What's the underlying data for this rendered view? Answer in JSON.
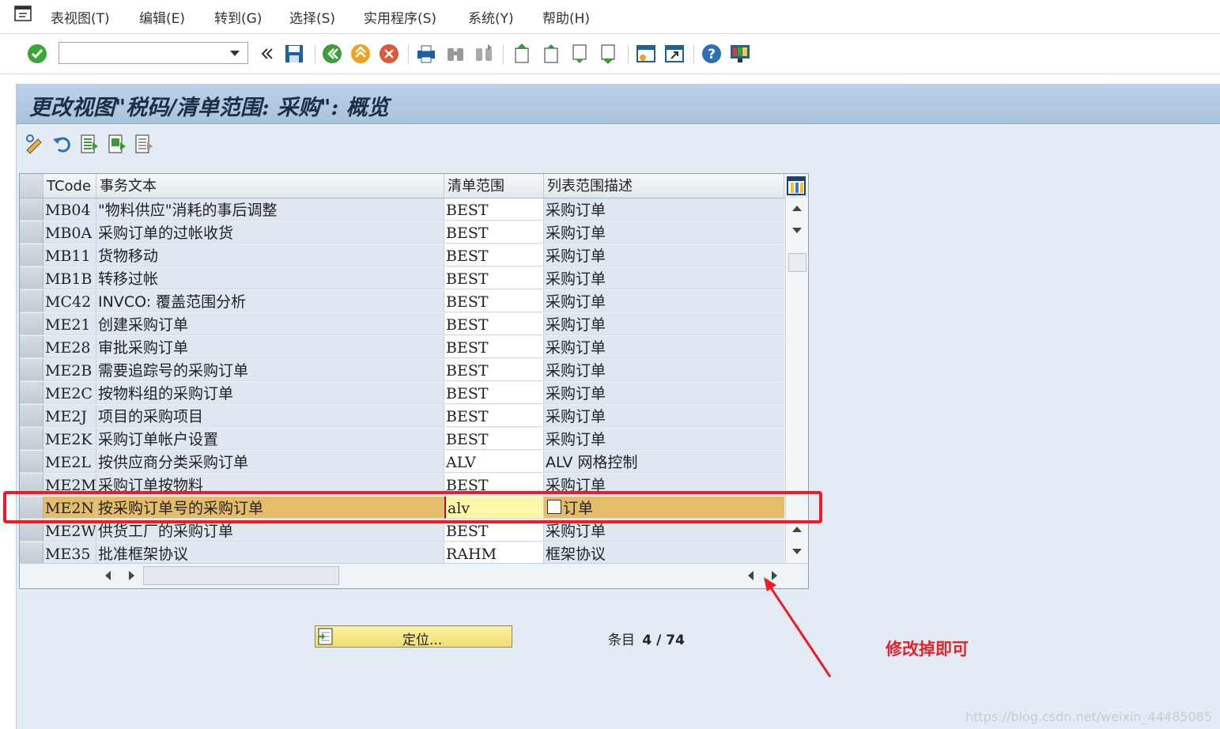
{
  "menu": [
    "表视图(T)",
    "编辑(E)",
    "转到(G)",
    "选择(S)",
    "实用程序(S)",
    "系统(Y)",
    "帮助(H)"
  ],
  "toolbar": {
    "command_value": "",
    "icons": [
      "enter-icon",
      "back-icon",
      "save-icon",
      "back-green-icon",
      "exit-icon",
      "cancel-icon",
      "print-icon",
      "find-icon",
      "find-next-icon",
      "first-page-icon",
      "prev-page-icon",
      "next-page-icon",
      "last-page-icon",
      "create-session-icon",
      "shortcut-icon",
      "help-icon",
      "customize-layout-icon"
    ]
  },
  "screen": {
    "title": "更改视图\"税码/清单范围: 采购\": 概览",
    "app_toolbar_icons": [
      "display-change-icon",
      "undo-icon",
      "select-all-icon",
      "select-block-icon",
      "deselect-all-icon"
    ]
  },
  "table": {
    "columns": [
      "TCode",
      "事务文本",
      "清单范围",
      "列表范围描述"
    ],
    "rows": [
      {
        "code": "MB04",
        "text": "\"物料供应\"消耗的事后调整",
        "scope": "BEST",
        "desc": "采购订单"
      },
      {
        "code": "MB0A",
        "text": "采购订单的过帐收货",
        "scope": "BEST",
        "desc": "采购订单"
      },
      {
        "code": "MB11",
        "text": "货物移动",
        "scope": "BEST",
        "desc": "采购订单"
      },
      {
        "code": "MB1B",
        "text": "转移过帐",
        "scope": "BEST",
        "desc": "采购订单"
      },
      {
        "code": "MC42",
        "text": "INVCO: 覆盖范围分析",
        "scope": "BEST",
        "desc": "采购订单"
      },
      {
        "code": "ME21",
        "text": "创建采购订单",
        "scope": "BEST",
        "desc": "采购订单"
      },
      {
        "code": "ME28",
        "text": "审批采购订单",
        "scope": "BEST",
        "desc": "采购订单"
      },
      {
        "code": "ME2B",
        "text": "需要追踪号的采购订单",
        "scope": "BEST",
        "desc": "采购订单"
      },
      {
        "code": "ME2C",
        "text": "按物料组的采购订单",
        "scope": "BEST",
        "desc": "采购订单"
      },
      {
        "code": "ME2J",
        "text": "项目的采购项目",
        "scope": "BEST",
        "desc": "采购订单"
      },
      {
        "code": "ME2K",
        "text": "采购订单帐户设置",
        "scope": "BEST",
        "desc": "采购订单"
      },
      {
        "code": "ME2L",
        "text": "按供应商分类采购订单",
        "scope": "ALV",
        "desc": "ALV 网格控制"
      },
      {
        "code": "ME2M",
        "text": "采购订单按物料",
        "scope": "BEST",
        "desc": "采购订单"
      },
      {
        "code": "ME2N",
        "text": "按采购订单号的采购订单",
        "scope": "alv",
        "desc": "订单"
      },
      {
        "code": "ME2W",
        "text": "供货工厂的采购订单",
        "scope": "BEST",
        "desc": "采购订单"
      },
      {
        "code": "ME35",
        "text": "批准框架协议",
        "scope": "RAHM",
        "desc": "框架协议"
      }
    ],
    "highlighted_row": 13
  },
  "bottom": {
    "position_button": "定位...",
    "entry_label": "条目",
    "entry_value": "4 / 74"
  },
  "annotation": "修改掉即可",
  "watermark": "https://blog.csdn.net/weixin_44485085",
  "colors": {
    "highlight_row": "#e5bc6a",
    "edit_cell": "#fff7a8",
    "annotation": "#ee1c25"
  }
}
